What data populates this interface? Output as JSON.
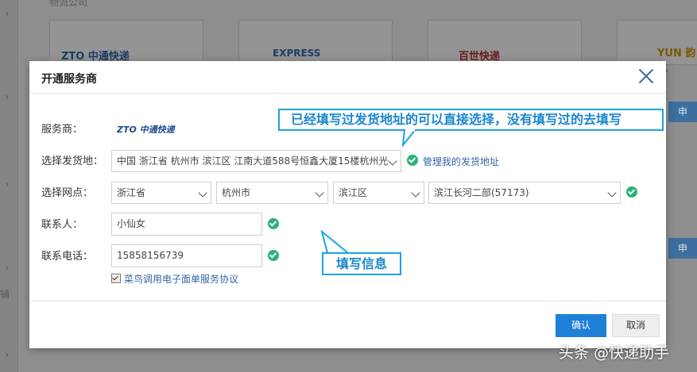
{
  "background": {
    "top_text": "物流公司",
    "side_label": "铺",
    "side_button_1": "申",
    "side_button_2": "申",
    "logos": [
      "ZTO 中通快递",
      "EXPRESS",
      "百世快递",
      "YUN 韵达"
    ]
  },
  "modal": {
    "title": "开通服务商",
    "labels": {
      "provider": "服务商：",
      "ship_from": "选择发货地：",
      "branch": "选择网点：",
      "contact": "联系人：",
      "phone": "联系电话："
    },
    "provider_logo": "ZTO 中通快递",
    "ship_from_value": "中国 浙江省 杭州市 滨江区 江南大道588号恒鑫大厦15楼杭州光",
    "manage_address_link": "管理我的发货地址",
    "branch": {
      "province": "浙江省",
      "city": "杭州市",
      "district": "滨江区",
      "outlet": "滨江长河二部(57173)"
    },
    "contact_value": "小仙女",
    "phone_value": "15858156739",
    "agreement": "菜鸟调用电子面单服务协议",
    "confirm": "确认",
    "cancel": "取消"
  },
  "annotations": {
    "tip_address": "已经填写过发货地址的可以直接选择，没有填写过的去填写",
    "tip_fill": "填写信息"
  },
  "watermark": "头条 @快递助手",
  "colors": {
    "accent": "#1e7fd6",
    "check": "#2ab27b",
    "link": "#3465a4",
    "callout": "#1aa5e0"
  }
}
